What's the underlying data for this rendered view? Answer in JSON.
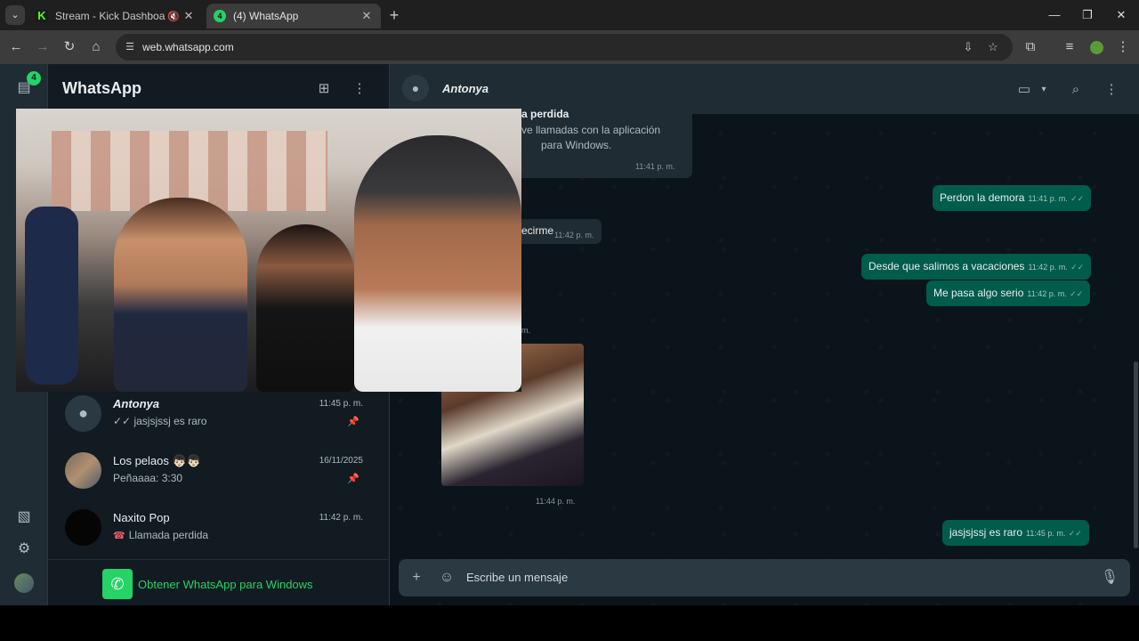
{
  "browser": {
    "tabs": [
      {
        "title": "Stream - Kick Dashboard",
        "favicon": "K"
      },
      {
        "title": "(4) WhatsApp",
        "favicon": "4"
      }
    ],
    "url": "web.whatsapp.com"
  },
  "rail": {
    "chats_badge": "4"
  },
  "sidebar": {
    "title": "WhatsApp",
    "chats": [
      {
        "name": "Antonya",
        "time": "11:45 p. m.",
        "preview": "✓✓ jasjsjssj es raro"
      },
      {
        "name": "Los pelaos 👦🏻👦🏻",
        "time": "16/11/2025",
        "preview": "Peñaaaa: 3:30"
      },
      {
        "name": "Naxito Pop",
        "time": "11:42 p. m.",
        "preview": "Llamada perdida"
      }
    ],
    "get_app": "Obtener WhatsApp para Windows"
  },
  "conversation": {
    "contact_name": "Antonya",
    "incoming_call_title": "a perdida",
    "incoming_call_text_1": "ve llamadas con la aplicación",
    "incoming_call_text_2": "para Windows.",
    "incoming_call_time": "11:41 p. m.",
    "incoming_partial_text": "ecirme",
    "incoming_partial_time": "11:42 p. m.",
    "incoming_partial_time_2": "m.",
    "image_time": "11:44 p. m.",
    "outgoing": [
      {
        "text": "Perdon la demora",
        "time": "11:41 p. m."
      },
      {
        "text": "Desde que salimos a vacaciones",
        "time": "11:42 p. m."
      },
      {
        "text": "Me pasa algo serio",
        "time": "11:42 p. m."
      },
      {
        "text": "jasjsjssj es raro",
        "time": "11:45 p. m."
      }
    ],
    "composer_placeholder": "Escribe un mensaje"
  }
}
